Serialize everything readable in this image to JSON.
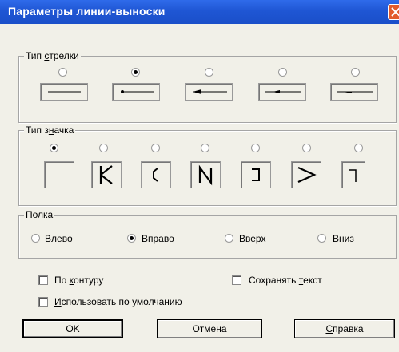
{
  "window": {
    "title": "Параметры линии-выноски"
  },
  "arrow_group": {
    "label_pre": "Тип ",
    "label_ul": "с",
    "label_post": "трелки",
    "selected_index": 1,
    "options": [
      "arrow-none-icon",
      "arrow-dot-icon",
      "arrow-filled-icon",
      "arrow-small-icon",
      "arrow-half-icon"
    ]
  },
  "sign_group": {
    "label_pre": "Тип з",
    "label_ul": "н",
    "label_post": "ачка",
    "selected_index": 0,
    "glyphs": [
      "",
      "K",
      "C",
      "N",
      "]",
      ">",
      "¬"
    ]
  },
  "shelf_group": {
    "label": "Полка",
    "selected_index": 1,
    "options": [
      {
        "pre": "В",
        "ul": "л",
        "post": "ево"
      },
      {
        "pre": "Вправ",
        "ul": "о",
        "post": ""
      },
      {
        "pre": "Ввер",
        "ul": "х",
        "post": ""
      },
      {
        "pre": "Вни",
        "ul": "з",
        "post": ""
      }
    ]
  },
  "checkboxes": {
    "contour": {
      "pre": "По ",
      "ul": "к",
      "post": "онтуру",
      "checked": false
    },
    "save_text": {
      "pre": "Сохранять ",
      "ul": "т",
      "post": "екст",
      "checked": false
    },
    "default": {
      "pre": "",
      "ul": "И",
      "post": "спользовать по умолчанию",
      "checked": false
    }
  },
  "buttons": {
    "ok": "OK",
    "cancel": "Отмена",
    "help_ul": "С",
    "help_post": "правка"
  }
}
